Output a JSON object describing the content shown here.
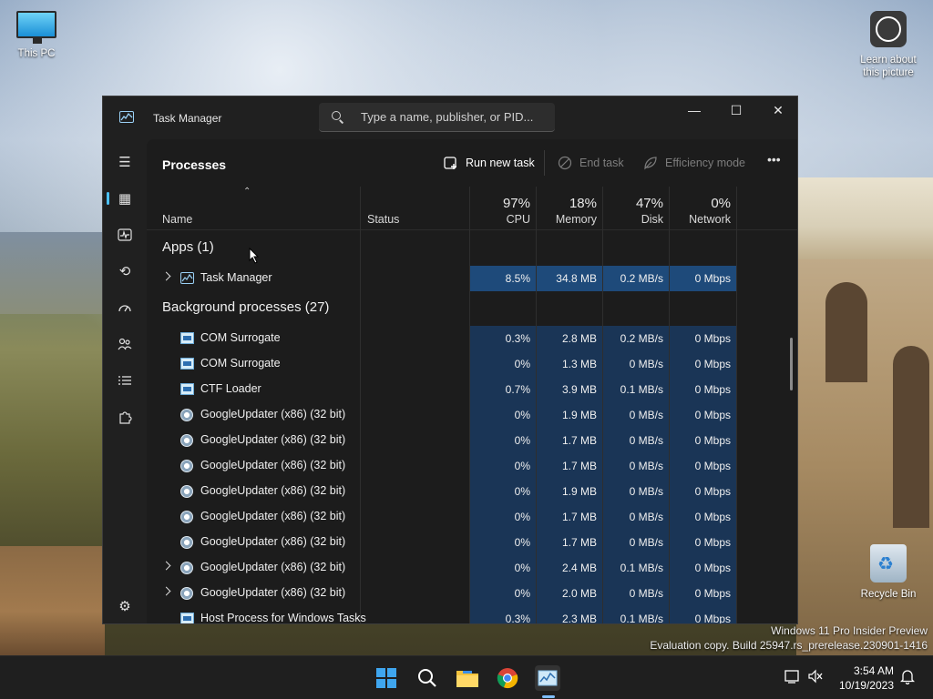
{
  "desktop": {
    "icons": [
      {
        "label": "This PC"
      },
      {
        "label": "Learn about this picture"
      },
      {
        "label": "Recycle Bin"
      }
    ],
    "watermark": {
      "line1": "Windows 11 Pro Insider Preview",
      "line2": "Evaluation copy. Build 25947.rs_prerelease.230901-1416"
    }
  },
  "window": {
    "title": "Task Manager",
    "search_placeholder": "Type a name, publisher, or PID...",
    "controls": {
      "minimize": "—",
      "maximize": "☐",
      "close": "✕"
    }
  },
  "sidebar": {
    "items": [
      {
        "name": "hamburger-menu",
        "icon": "☰"
      },
      {
        "name": "processes",
        "icon": "▦",
        "active": true
      },
      {
        "name": "performance",
        "icon": "📈"
      },
      {
        "name": "app-history",
        "icon": "⟲"
      },
      {
        "name": "startup-apps",
        "icon": "⚡"
      },
      {
        "name": "users",
        "icon": "👥"
      },
      {
        "name": "details",
        "icon": "☷"
      },
      {
        "name": "services",
        "icon": "⚙"
      },
      {
        "name": "settings",
        "icon": "⚙"
      }
    ]
  },
  "toolbar": {
    "page_title": "Processes",
    "run_new_task": "Run new task",
    "end_task": "End task",
    "efficiency_mode": "Efficiency mode",
    "more": "•••"
  },
  "columns": {
    "name": "Name",
    "status": "Status",
    "cpu": {
      "pct": "97%",
      "label": "CPU"
    },
    "memory": {
      "pct": "18%",
      "label": "Memory"
    },
    "disk": {
      "pct": "47%",
      "label": "Disk"
    },
    "network": {
      "pct": "0%",
      "label": "Network"
    }
  },
  "groups": {
    "apps": "Apps (1)",
    "background": "Background processes (27)"
  },
  "apps": [
    {
      "name": "Task Manager",
      "cpu": "8.5%",
      "memory": "34.8 MB",
      "disk": "0.2 MB/s",
      "network": "0 Mbps",
      "expandable": true,
      "icon": "chart"
    }
  ],
  "processes": [
    {
      "name": "COM Surrogate",
      "cpu": "0.3%",
      "memory": "2.8 MB",
      "disk": "0.2 MB/s",
      "network": "0 Mbps",
      "expandable": false,
      "icon": "box"
    },
    {
      "name": "COM Surrogate",
      "cpu": "0%",
      "memory": "1.3 MB",
      "disk": "0 MB/s",
      "network": "0 Mbps",
      "expandable": false,
      "icon": "box"
    },
    {
      "name": "CTF Loader",
      "cpu": "0.7%",
      "memory": "3.9 MB",
      "disk": "0.1 MB/s",
      "network": "0 Mbps",
      "expandable": false,
      "icon": "box"
    },
    {
      "name": "GoogleUpdater (x86) (32 bit)",
      "cpu": "0%",
      "memory": "1.9 MB",
      "disk": "0 MB/s",
      "network": "0 Mbps",
      "expandable": false,
      "icon": "upd"
    },
    {
      "name": "GoogleUpdater (x86) (32 bit)",
      "cpu": "0%",
      "memory": "1.7 MB",
      "disk": "0 MB/s",
      "network": "0 Mbps",
      "expandable": false,
      "icon": "upd"
    },
    {
      "name": "GoogleUpdater (x86) (32 bit)",
      "cpu": "0%",
      "memory": "1.7 MB",
      "disk": "0 MB/s",
      "network": "0 Mbps",
      "expandable": false,
      "icon": "upd"
    },
    {
      "name": "GoogleUpdater (x86) (32 bit)",
      "cpu": "0%",
      "memory": "1.9 MB",
      "disk": "0 MB/s",
      "network": "0 Mbps",
      "expandable": false,
      "icon": "upd"
    },
    {
      "name": "GoogleUpdater (x86) (32 bit)",
      "cpu": "0%",
      "memory": "1.7 MB",
      "disk": "0 MB/s",
      "network": "0 Mbps",
      "expandable": false,
      "icon": "upd"
    },
    {
      "name": "GoogleUpdater (x86) (32 bit)",
      "cpu": "0%",
      "memory": "1.7 MB",
      "disk": "0 MB/s",
      "network": "0 Mbps",
      "expandable": false,
      "icon": "upd"
    },
    {
      "name": "GoogleUpdater (x86) (32 bit)",
      "cpu": "0%",
      "memory": "2.4 MB",
      "disk": "0.1 MB/s",
      "network": "0 Mbps",
      "expandable": true,
      "icon": "upd"
    },
    {
      "name": "GoogleUpdater (x86) (32 bit)",
      "cpu": "0%",
      "memory": "2.0 MB",
      "disk": "0 MB/s",
      "network": "0 Mbps",
      "expandable": true,
      "icon": "upd"
    },
    {
      "name": "Host Process for Windows Tasks",
      "cpu": "0.3%",
      "memory": "2.3 MB",
      "disk": "0.1 MB/s",
      "network": "0 Mbps",
      "expandable": false,
      "icon": "box"
    }
  ],
  "taskbar": {
    "time": "3:54 AM",
    "date": "10/19/2023",
    "apps": [
      "start-icon",
      "search-icon",
      "file-explorer-icon",
      "chrome-icon",
      "task-manager-icon"
    ]
  }
}
